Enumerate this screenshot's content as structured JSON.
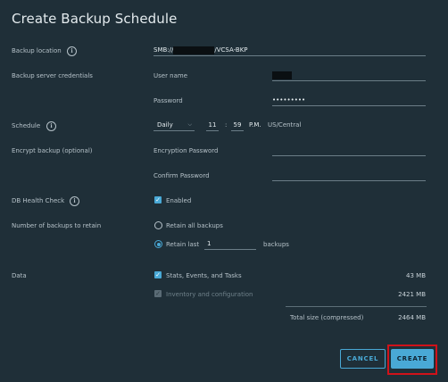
{
  "dialog": {
    "title": "Create Backup Schedule"
  },
  "form": {
    "backup_location": {
      "label": "Backup location",
      "value_prefix": "SMB://",
      "value_suffix": "/VCSA-BKP"
    },
    "credentials": {
      "label": "Backup server credentials",
      "username_label": "User name",
      "password_label": "Password",
      "password_value": "•••••••••"
    },
    "schedule": {
      "label": "Schedule",
      "frequency": "Daily",
      "hour": "11",
      "separator": ":",
      "minute": "59",
      "ampm": "P.M.",
      "timezone": "US/Central"
    },
    "encrypt": {
      "label": "Encrypt backup (optional)",
      "encryption_password_label": "Encryption Password",
      "confirm_password_label": "Confirm Password"
    },
    "db_health": {
      "label": "DB Health Check",
      "enabled_label": "Enabled",
      "checked": true
    },
    "retain": {
      "label": "Number of backups to retain",
      "retain_all_label": "Retain all backups",
      "retain_last_label": "Retain last",
      "retain_last_value": "1",
      "backups_suffix": "backups"
    },
    "data": {
      "label": "Data",
      "items": [
        {
          "label": "Stats, Events, and Tasks",
          "size": "43 MB",
          "checked": true,
          "disabled": false
        },
        {
          "label": "Inventory and configuration",
          "size": "2421 MB",
          "checked": true,
          "disabled": true
        }
      ],
      "total_label": "Total size (compressed)",
      "total_size": "2464 MB"
    }
  },
  "buttons": {
    "cancel": "CANCEL",
    "create": "CREATE"
  },
  "colors": {
    "dialog_bg": "#1f2f38",
    "accent": "#49a9d6",
    "highlight": "#d0121a"
  }
}
